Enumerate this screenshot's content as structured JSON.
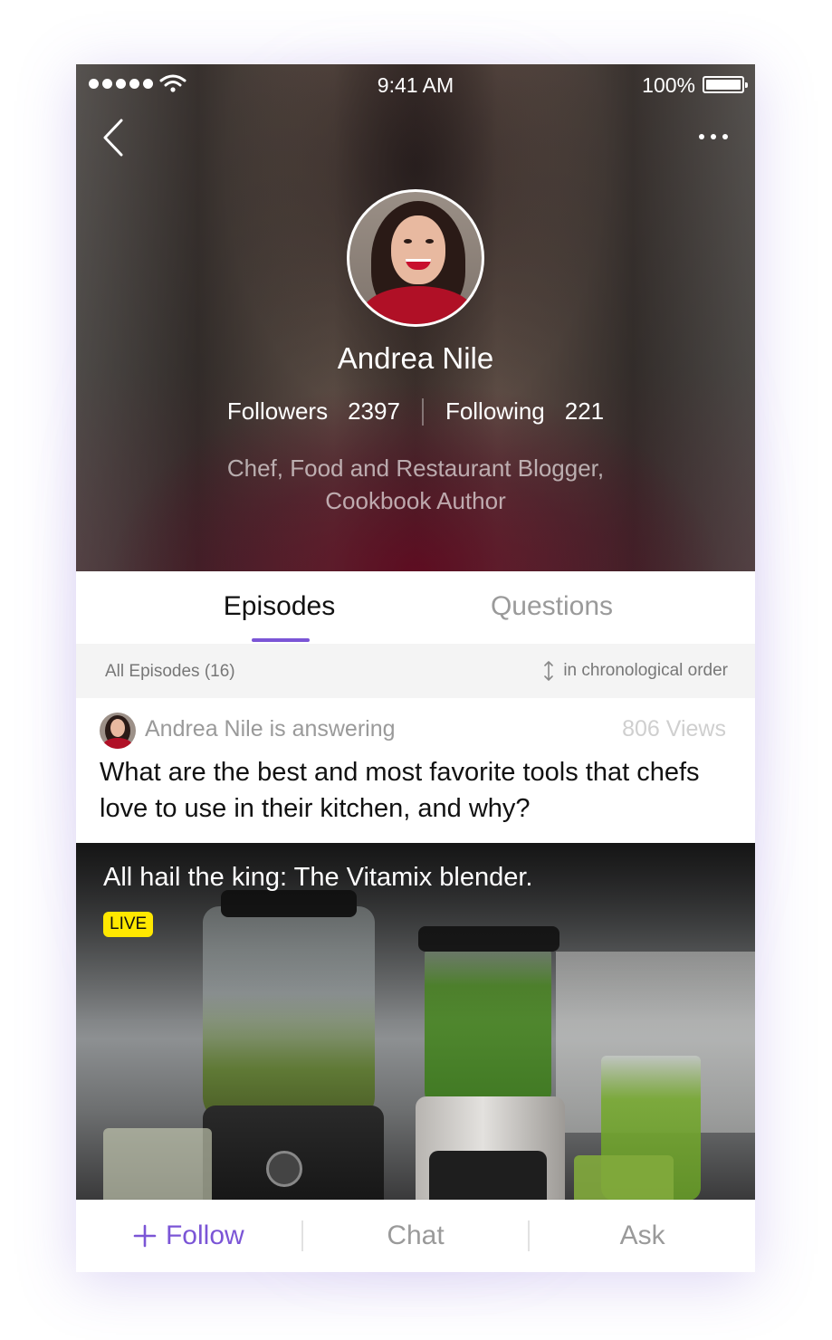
{
  "statusbar": {
    "time": "9:41 AM",
    "battery": "100%"
  },
  "icons": {
    "back": "chevron-left-icon",
    "more": "more-horizontal-icon",
    "wifi": "wifi-icon",
    "signal": "signal-dots-icon",
    "battery": "battery-icon",
    "sort": "sort-arrows-icon",
    "plus": "plus-icon"
  },
  "profile": {
    "name": "Andrea Nile",
    "followers_label": "Followers",
    "followers_count": "2397",
    "following_label": "Following",
    "following_count": "221",
    "bio_line1": "Chef, Food and Restaurant Blogger,",
    "bio_line2": "Cookbook Author"
  },
  "tabs": [
    {
      "label": "Episodes",
      "active": true
    },
    {
      "label": "Questions",
      "active": false
    }
  ],
  "sortbar": {
    "count_label": "All Episodes (16)",
    "sort_label": "in chronological order"
  },
  "post": {
    "author_line": "Andrea Nile is answering",
    "views": "806 Views",
    "question": "What are the best and most favorite tools that chefs love to use in their kitchen, and why?"
  },
  "media": {
    "title": "All hail the king: The Vitamix blender.",
    "badge": "LIVE"
  },
  "bottombar": {
    "follow": "Follow",
    "chat": "Chat",
    "ask": "Ask"
  },
  "colors": {
    "accent": "#7b55d6",
    "live_badge": "#ffe800"
  }
}
